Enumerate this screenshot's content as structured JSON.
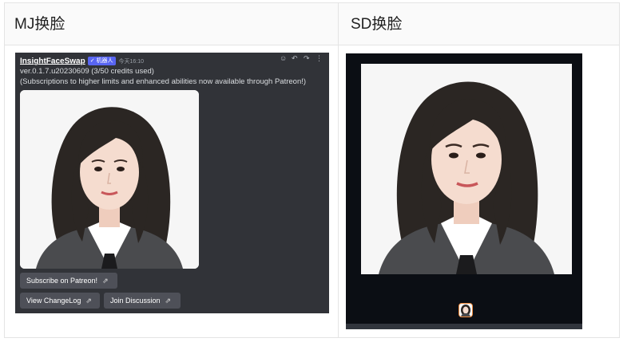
{
  "table": {
    "header_left": "MJ换脸",
    "header_right": "SD换脸"
  },
  "discord": {
    "author": "InsightFaceSwap",
    "bot_tag": "✓ 机器人",
    "timestamp": "今天16:10",
    "line1": "ver.0.1.7.u20230609 (3/50 credits used)",
    "line2": "(Subscriptions to higher limits and enhanced abilities now available through Patreon!)",
    "buttons": {
      "subscribe": "Subscribe on Patreon!",
      "changelog": "View ChangeLog",
      "discussion": "Join Discussion"
    },
    "icons": [
      "reaction-icon",
      "reply-icon",
      "forward-icon",
      "more-icon"
    ]
  },
  "colors": {
    "discord_bg": "#313338",
    "button_bg": "#4e5058",
    "bot_tag": "#5865f2",
    "sd_bg": "#0b0e14"
  }
}
